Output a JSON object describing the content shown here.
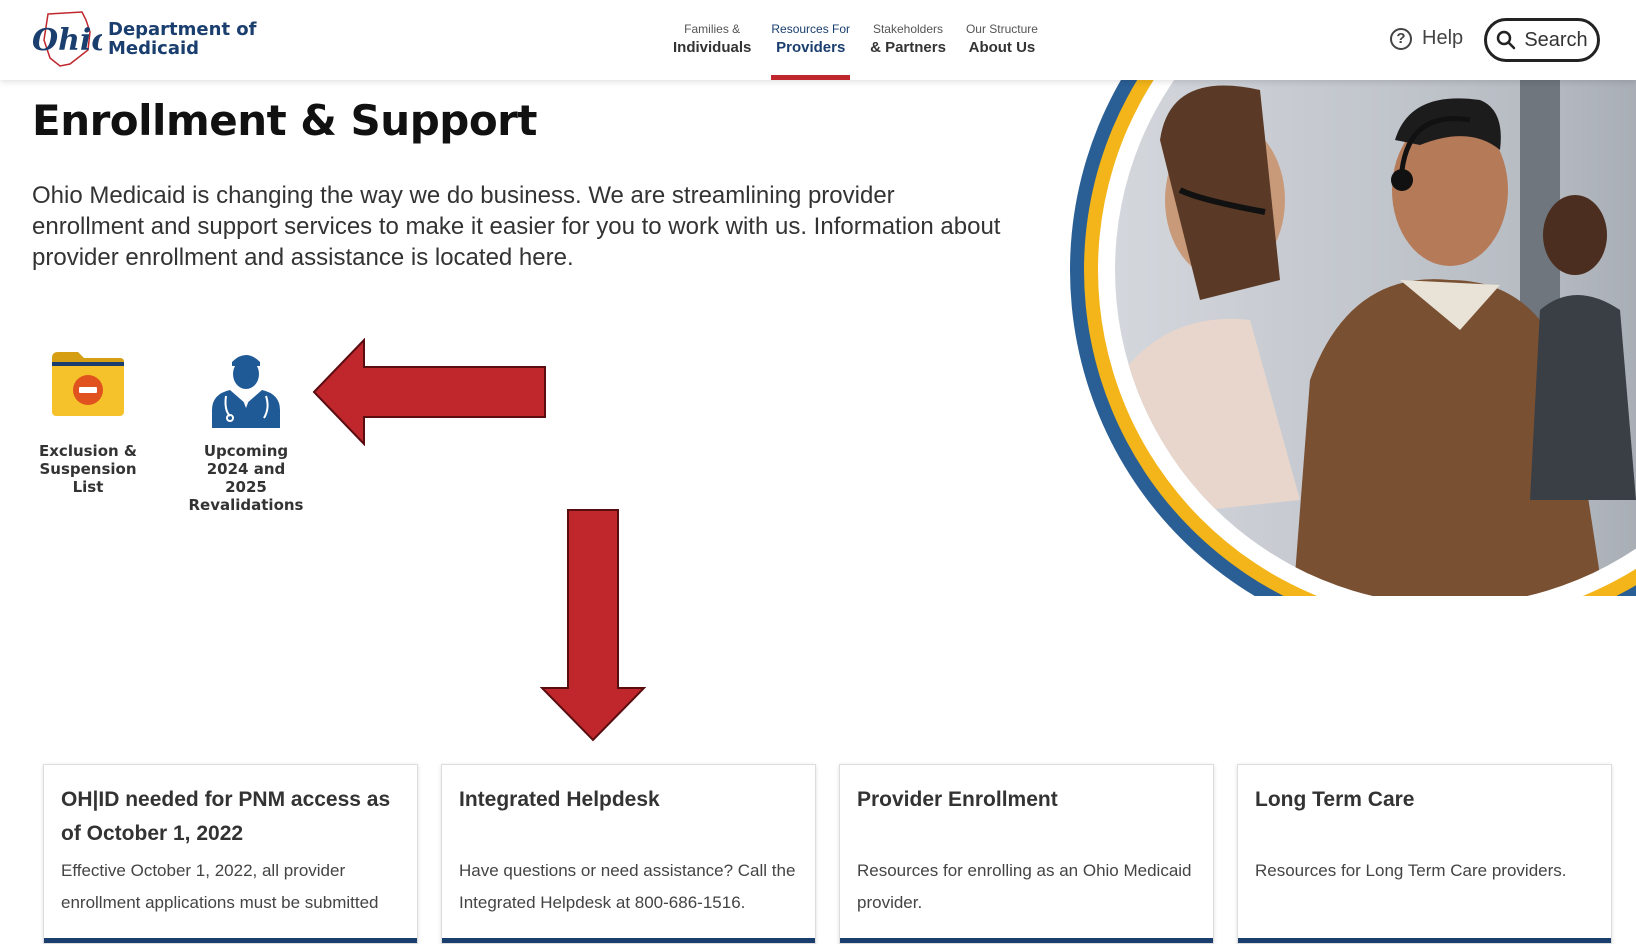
{
  "header": {
    "logo_script": "Ohio",
    "logo_line1": "Department of",
    "logo_line2": "Medicaid",
    "nav": [
      {
        "small": "Families &",
        "big": "Individuals",
        "active": false
      },
      {
        "small": "Resources For",
        "big": "Providers",
        "active": true
      },
      {
        "small": "Stakeholders",
        "big": "& Partners",
        "active": false
      },
      {
        "small": "Our Structure",
        "big": "About Us",
        "active": false
      }
    ],
    "help_label": "Help",
    "help_glyph": "?",
    "search_label": "Search"
  },
  "main": {
    "title": "Enrollment & Support",
    "intro": "Ohio Medicaid is changing the way we do business. We are streamlining provider enrollment and support services to make it easier for you to work with us. Information about provider enrollment and assistance is located here."
  },
  "tiles": [
    {
      "label": "Exclusion &\nSuspension\nList",
      "icon": "folder-minus-icon"
    },
    {
      "label": "Upcoming\n2024 and 2025\nRevalidations",
      "icon": "doctor-icon"
    }
  ],
  "cards": [
    {
      "title": "OH|ID needed for PNM access as of October 1, 2022",
      "body": "Effective October 1, 2022, all provider enrollment applications must be submitted"
    },
    {
      "title": "Integrated Helpdesk",
      "body": "Have questions or need assistance? Call the Integrated Helpdesk at 800-686-1516."
    },
    {
      "title": "Provider Enrollment",
      "body": "Resources for enrolling as an Ohio Medicaid provider."
    },
    {
      "title": "Long Term Care",
      "body": "Resources for Long Term Care providers."
    }
  ],
  "colors": {
    "brand_navy": "#1a3e6e",
    "accent_red": "#c0272d",
    "ring_yellow": "#f3b519",
    "ring_blue": "#2a5f95",
    "folder_yellow": "#f5c22b",
    "doctor_blue": "#1f5a97"
  }
}
